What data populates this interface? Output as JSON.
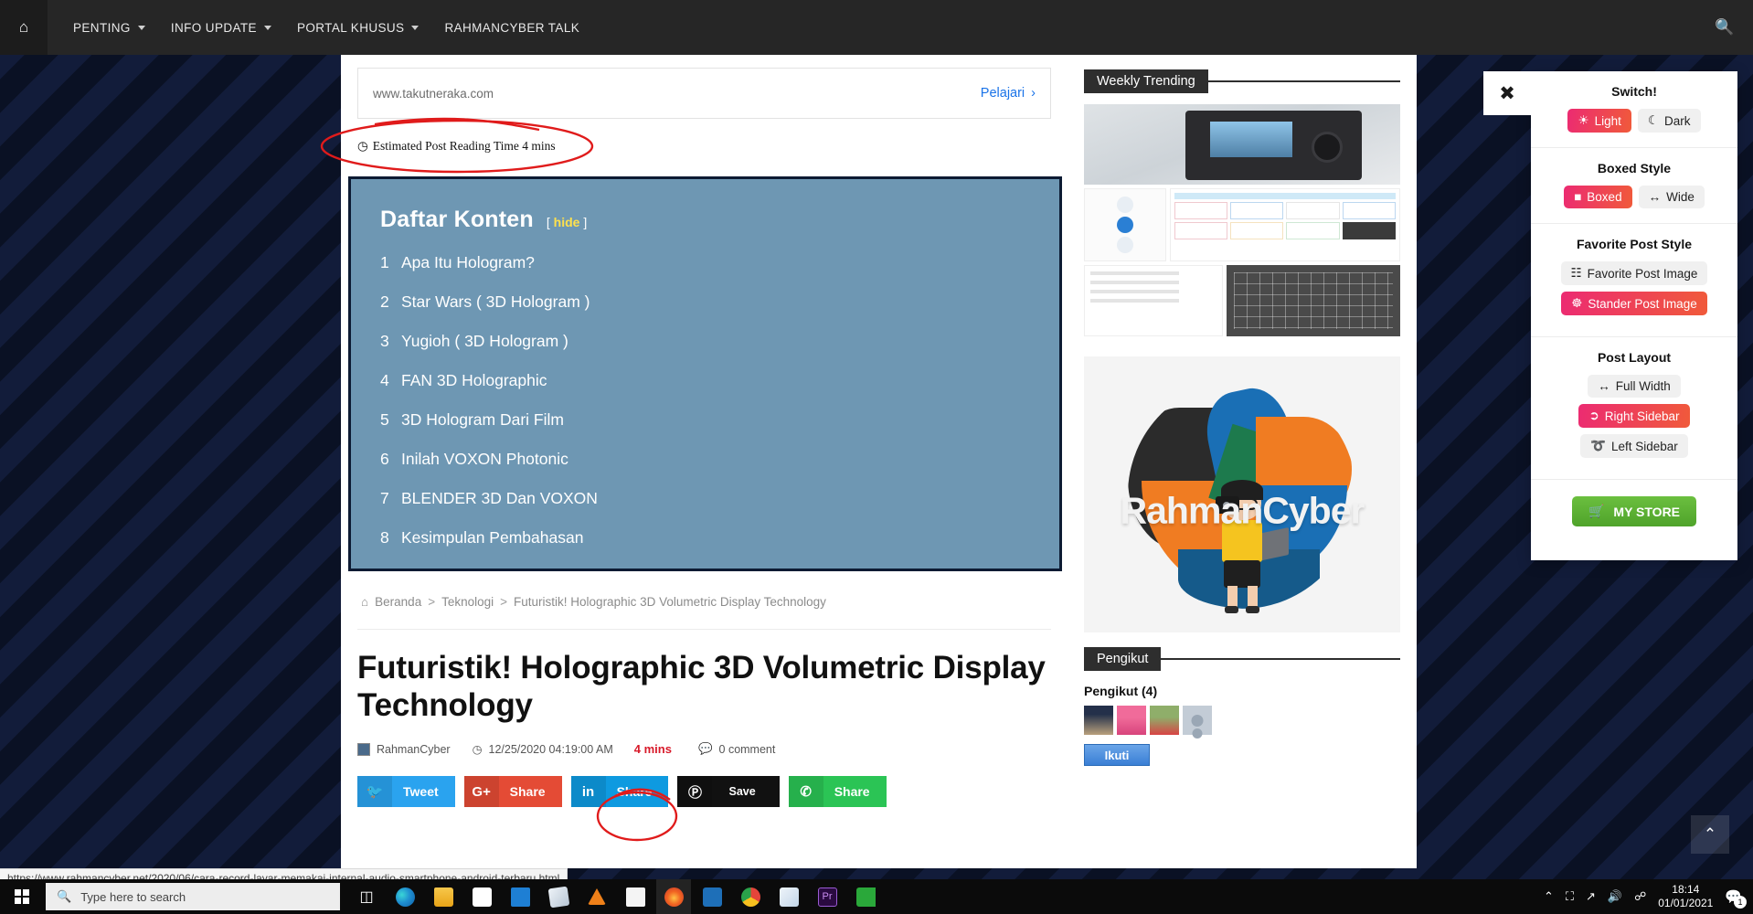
{
  "topnav": {
    "home_icon": "home-icon",
    "items": [
      {
        "label": "PENTING",
        "has_caret": true
      },
      {
        "label": "INFO UPDATE",
        "has_caret": true
      },
      {
        "label": "PORTAL KHUSUS",
        "has_caret": true
      },
      {
        "label": "RAHMANCYBER TALK",
        "has_caret": false
      }
    ],
    "search_icon": "search-icon"
  },
  "ad": {
    "url": "www.takutneraka.com",
    "cta": "Pelajari",
    "cta_icon": "chevron-right-icon"
  },
  "reading_time": {
    "icon": "clock-icon",
    "text": "Estimated Post Reading Time 4 mins"
  },
  "toc": {
    "title": "Daftar Konten",
    "hide_open": "[",
    "hide_label": "hide",
    "hide_close": "]",
    "items": [
      {
        "num": "1",
        "label": "Apa Itu Hologram?"
      },
      {
        "num": "2",
        "label": "Star Wars ( 3D Hologram )"
      },
      {
        "num": "3",
        "label": "Yugioh ( 3D Hologram )"
      },
      {
        "num": "4",
        "label": "FAN 3D Holographic"
      },
      {
        "num": "5",
        "label": "3D Hologram Dari Film"
      },
      {
        "num": "6",
        "label": "Inilah VOXON Photonic"
      },
      {
        "num": "7",
        "label": "BLENDER 3D Dan VOXON"
      },
      {
        "num": "8",
        "label": "Kesimpulan Pembahasan"
      }
    ]
  },
  "breadcrumb": {
    "home_icon": "home-icon",
    "home": "Beranda",
    "sep": ">",
    "category": "Teknologi",
    "current": "Futuristik! Holographic 3D Volumetric Display Technology"
  },
  "post": {
    "title": "Futuristik! Holographic 3D Volumetric Display Technology",
    "author": "RahmanCyber",
    "date_icon": "clock-icon",
    "date": "12/25/2020 04:19:00 AM",
    "mins": "4 mins",
    "comment_icon": "comment-icon",
    "comments": "0 comment"
  },
  "share": [
    {
      "name": "twitter",
      "icon": "twitter-icon",
      "glyph": "❦",
      "label": "Tweet"
    },
    {
      "name": "google-plus",
      "icon": "google-plus-icon",
      "glyph": "G+",
      "label": "Share"
    },
    {
      "name": "linkedin",
      "icon": "linkedin-icon",
      "glyph": "in",
      "label": "Share"
    },
    {
      "name": "pinterest",
      "icon": "pinterest-icon",
      "glyph": "ⓟ",
      "label": "Save"
    },
    {
      "name": "whatsapp",
      "icon": "whatsapp-icon",
      "glyph": "✆",
      "label": "Share"
    }
  ],
  "sidebar": {
    "trending_title": "Weekly Trending",
    "followers_title": "Pengikut",
    "followers_count": "Pengikut (4)",
    "follow_button": "Ikuti"
  },
  "settings": {
    "close_icon": "close-icon",
    "sections": [
      {
        "title": "Switch!",
        "options": [
          {
            "label": "Light",
            "icon": "sun-icon",
            "glyph": "☀",
            "active": true
          },
          {
            "label": "Dark",
            "icon": "moon-icon",
            "glyph": "☾",
            "active": false
          }
        ]
      },
      {
        "title": "Boxed Style",
        "options": [
          {
            "label": "Boxed",
            "icon": "square-icon",
            "glyph": "■",
            "active": true
          },
          {
            "label": "Wide",
            "icon": "arrows-horizontal-icon",
            "glyph": "↔",
            "active": false
          }
        ]
      },
      {
        "title": "Favorite Post Style",
        "options": [
          {
            "label": "Favorite Post Image",
            "icon": "list-grid-icon",
            "glyph": "☷",
            "active": false
          },
          {
            "label": "Stander Post Image",
            "icon": "grid-icon",
            "glyph": "⌸",
            "active": true
          }
        ]
      },
      {
        "title": "Post Layout",
        "options": [
          {
            "label": "Full Width",
            "icon": "arrows-horizontal-icon",
            "glyph": "↔",
            "active": false
          },
          {
            "label": "Right Sidebar",
            "icon": "arrow-right-circle-icon",
            "glyph": "➡",
            "active": true
          },
          {
            "label": "Left Sidebar",
            "icon": "arrow-left-circle-icon",
            "glyph": "⬅",
            "active": false
          }
        ]
      }
    ],
    "store_button": {
      "label": "MY STORE",
      "icon": "cart-icon",
      "glyph": "🛒"
    },
    "accent": "#ec2b72",
    "store_color": "#5fb634"
  },
  "back_to_top": {
    "icon": "chevron-up-icon",
    "glyph": "⌃"
  },
  "status_url": "https://www.rahmancyber.net/2020/06/cara-record-layar-memakai-internal-audio-smartphone-android-terbaru.html",
  "taskbar": {
    "start_icon": "windows-logo-icon",
    "search_icon": "search-icon",
    "search_placeholder": "Type here to search",
    "task_view_icon": "task-view-icon",
    "apps": [
      {
        "name": "edge-icon",
        "color": "#1f7ec4"
      },
      {
        "name": "file-explorer-icon",
        "color": "#f0b429"
      },
      {
        "name": "microsoft-store-icon",
        "color": "#ffffff"
      },
      {
        "name": "mail-icon",
        "color": "#1e7fd4"
      },
      {
        "name": "sticky-notes-icon",
        "color": "#dfe6ee"
      },
      {
        "name": "vlc-icon",
        "color": "#ef8019"
      },
      {
        "name": "movie-maker-icon",
        "color": "#f2f2f2"
      },
      {
        "name": "firefox-icon",
        "color": "#f26522",
        "running": true
      },
      {
        "name": "media-player-icon",
        "color": "#1e6fb8"
      },
      {
        "name": "chrome-icon",
        "color": "#e5453a"
      },
      {
        "name": "snipping-tool-icon",
        "color": "#d9e6f2"
      },
      {
        "name": "premiere-pro-icon",
        "color": "#2a0a40"
      },
      {
        "name": "camtasia-icon",
        "color": "#2aa83a"
      }
    ],
    "tray": {
      "show_hidden_icon": "chevron-up-icon",
      "webcam_icon": "webcam-icon",
      "wifi_icon": "wifi-icon",
      "volume_icon": "volume-icon",
      "bluetooth_icon": "bluetooth-icon",
      "time": "18:14",
      "date": "01/01/2021",
      "notification_icon": "notification-icon",
      "notification_count": "1"
    }
  }
}
